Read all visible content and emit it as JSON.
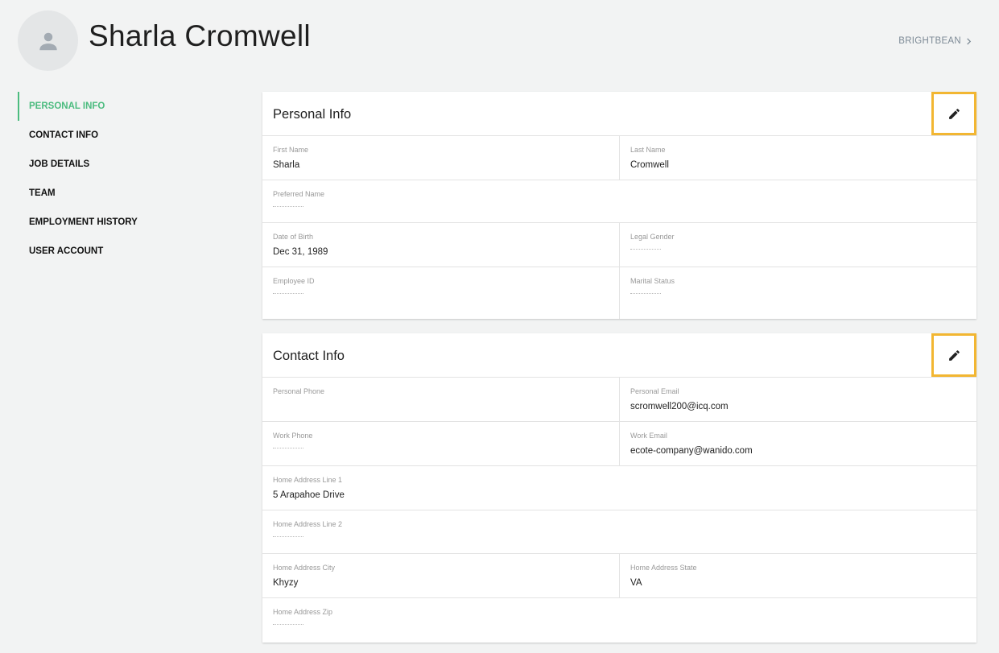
{
  "profile": {
    "name": "Sharla Cromwell",
    "org_link": "BRIGHTBEAN"
  },
  "nav": {
    "items": [
      {
        "label": "PERSONAL INFO",
        "active": true
      },
      {
        "label": "CONTACT INFO",
        "active": false
      },
      {
        "label": "JOB DETAILS",
        "active": false
      },
      {
        "label": "TEAM",
        "active": false
      },
      {
        "label": "EMPLOYMENT HISTORY",
        "active": false
      },
      {
        "label": "USER ACCOUNT",
        "active": false
      }
    ]
  },
  "personal_info": {
    "title": "Personal Info",
    "first_name_label": "First Name",
    "first_name": "Sharla",
    "last_name_label": "Last Name",
    "last_name": "Cromwell",
    "preferred_name_label": "Preferred Name",
    "preferred_name": "",
    "dob_label": "Date of Birth",
    "dob": "Dec 31, 1989",
    "legal_gender_label": "Legal Gender",
    "legal_gender": "",
    "employee_id_label": "Employee ID",
    "employee_id": "",
    "marital_status_label": "Marital Status",
    "marital_status": ""
  },
  "contact_info": {
    "title": "Contact Info",
    "personal_phone_label": "Personal Phone",
    "personal_phone": "",
    "personal_email_label": "Personal Email",
    "personal_email": "scromwell200@icq.com",
    "work_phone_label": "Work Phone",
    "work_phone": "",
    "work_email_label": "Work Email",
    "work_email": "ecote-company@wanido.com",
    "address1_label": "Home Address Line 1",
    "address1": "5 Arapahoe Drive",
    "address2_label": "Home Address Line 2",
    "address2": "",
    "city_label": "Home Address City",
    "city": "Khyzy",
    "state_label": "Home Address State",
    "state": "VA",
    "zip_label": "Home Address Zip",
    "zip": ""
  },
  "colors": {
    "accent": "#4cbc7f",
    "highlight": "#f2b632",
    "background": "#f2f3f3"
  },
  "icons": {
    "avatar": "person-icon",
    "edit": "pencil-icon",
    "chevron": "chevron-right-icon"
  }
}
